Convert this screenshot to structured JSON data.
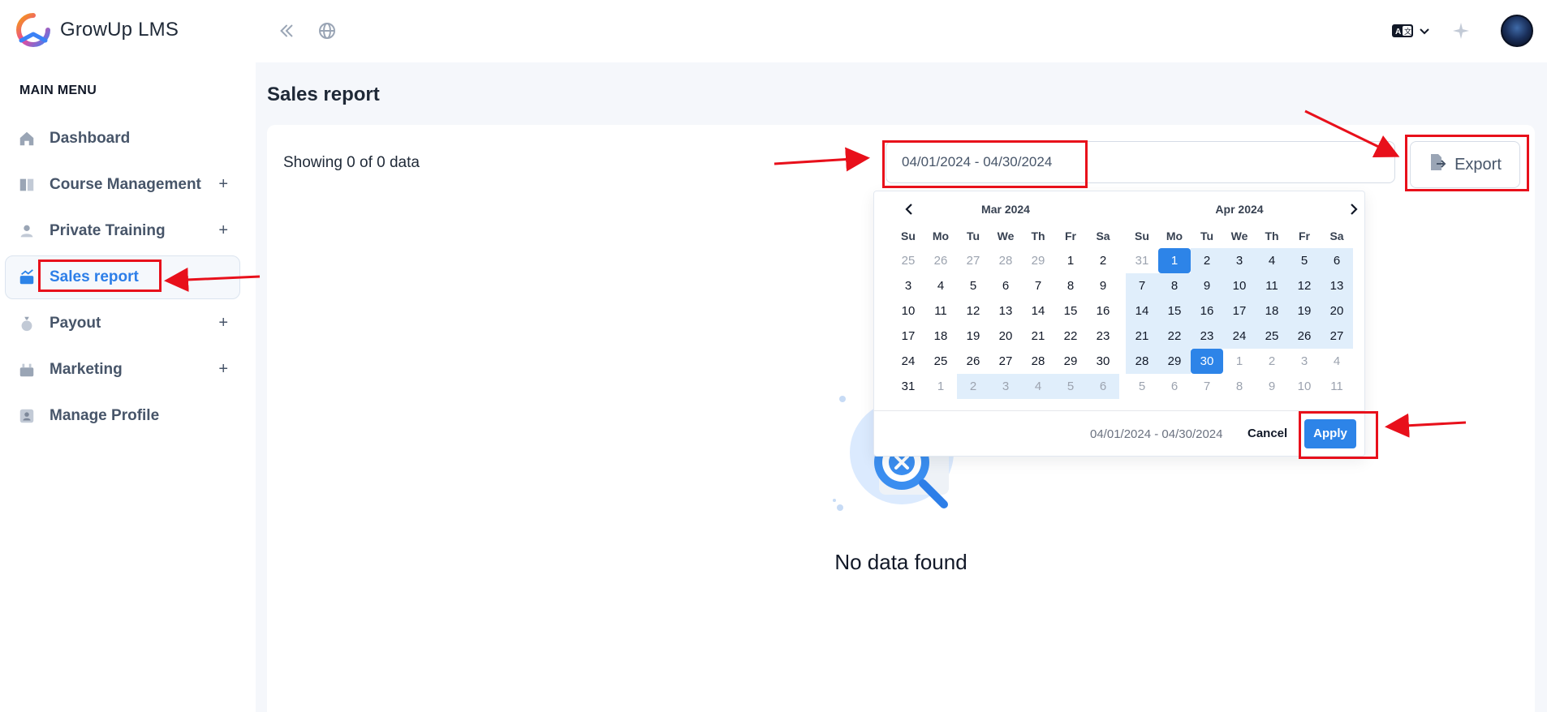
{
  "app": {
    "name": "GrowUp LMS"
  },
  "sidebar": {
    "menu_title": "MAIN MENU",
    "items": [
      {
        "label": "Dashboard",
        "icon": "home-icon",
        "has_submenu": false
      },
      {
        "label": "Course Management",
        "icon": "book-icon",
        "has_submenu": true
      },
      {
        "label": "Private Training",
        "icon": "users-icon",
        "has_submenu": true
      },
      {
        "label": "Sales report",
        "icon": "chart-icon",
        "has_submenu": false,
        "active": true
      },
      {
        "label": "Payout",
        "icon": "money-bag-icon",
        "has_submenu": true
      },
      {
        "label": "Marketing",
        "icon": "megaphone-icon",
        "has_submenu": true
      },
      {
        "label": "Manage Profile",
        "icon": "profile-icon",
        "has_submenu": false
      }
    ],
    "submenu_symbol": "+"
  },
  "topbar": {
    "collapse_icon": "double-chevron-left-icon",
    "globe_icon": "globe-icon",
    "language_icon": "translate-icon",
    "dropdown_icon": "chevron-down-icon",
    "sparkle_icon": "sparkle-icon",
    "avatar_icon": "user-avatar"
  },
  "page": {
    "title": "Sales report",
    "showing_text": "Showing 0 of 0 data",
    "date_range_value": "04/01/2024 - 04/30/2024",
    "export_label": "Export",
    "empty_text": "No data found"
  },
  "datepicker": {
    "weekdays": [
      "Su",
      "Mo",
      "Tu",
      "We",
      "Th",
      "Fr",
      "Sa"
    ],
    "left": {
      "title": "Mar 2024",
      "days": [
        {
          "d": "25",
          "s": "off"
        },
        {
          "d": "26",
          "s": "off"
        },
        {
          "d": "27",
          "s": "off"
        },
        {
          "d": "28",
          "s": "off"
        },
        {
          "d": "29",
          "s": "off"
        },
        {
          "d": "1",
          "s": ""
        },
        {
          "d": "2",
          "s": ""
        },
        {
          "d": "3",
          "s": ""
        },
        {
          "d": "4",
          "s": ""
        },
        {
          "d": "5",
          "s": ""
        },
        {
          "d": "6",
          "s": ""
        },
        {
          "d": "7",
          "s": ""
        },
        {
          "d": "8",
          "s": ""
        },
        {
          "d": "9",
          "s": ""
        },
        {
          "d": "10",
          "s": ""
        },
        {
          "d": "11",
          "s": ""
        },
        {
          "d": "12",
          "s": ""
        },
        {
          "d": "13",
          "s": ""
        },
        {
          "d": "14",
          "s": ""
        },
        {
          "d": "15",
          "s": ""
        },
        {
          "d": "16",
          "s": ""
        },
        {
          "d": "17",
          "s": ""
        },
        {
          "d": "18",
          "s": ""
        },
        {
          "d": "19",
          "s": ""
        },
        {
          "d": "20",
          "s": ""
        },
        {
          "d": "21",
          "s": ""
        },
        {
          "d": "22",
          "s": ""
        },
        {
          "d": "23",
          "s": ""
        },
        {
          "d": "24",
          "s": ""
        },
        {
          "d": "25",
          "s": ""
        },
        {
          "d": "26",
          "s": ""
        },
        {
          "d": "27",
          "s": ""
        },
        {
          "d": "28",
          "s": ""
        },
        {
          "d": "29",
          "s": ""
        },
        {
          "d": "30",
          "s": ""
        },
        {
          "d": "31",
          "s": ""
        },
        {
          "d": "1",
          "s": "off"
        },
        {
          "d": "2",
          "s": "off range"
        },
        {
          "d": "3",
          "s": "off range"
        },
        {
          "d": "4",
          "s": "off range"
        },
        {
          "d": "5",
          "s": "off range"
        },
        {
          "d": "6",
          "s": "off range"
        }
      ]
    },
    "right": {
      "title": "Apr 2024",
      "days": [
        {
          "d": "31",
          "s": "off"
        },
        {
          "d": "1",
          "s": "sel"
        },
        {
          "d": "2",
          "s": "range"
        },
        {
          "d": "3",
          "s": "range"
        },
        {
          "d": "4",
          "s": "range"
        },
        {
          "d": "5",
          "s": "range"
        },
        {
          "d": "6",
          "s": "range"
        },
        {
          "d": "7",
          "s": "range"
        },
        {
          "d": "8",
          "s": "range"
        },
        {
          "d": "9",
          "s": "range"
        },
        {
          "d": "10",
          "s": "range"
        },
        {
          "d": "11",
          "s": "range"
        },
        {
          "d": "12",
          "s": "range"
        },
        {
          "d": "13",
          "s": "range"
        },
        {
          "d": "14",
          "s": "range"
        },
        {
          "d": "15",
          "s": "range"
        },
        {
          "d": "16",
          "s": "range"
        },
        {
          "d": "17",
          "s": "range"
        },
        {
          "d": "18",
          "s": "range"
        },
        {
          "d": "19",
          "s": "range"
        },
        {
          "d": "20",
          "s": "range"
        },
        {
          "d": "21",
          "s": "range"
        },
        {
          "d": "22",
          "s": "range"
        },
        {
          "d": "23",
          "s": "range"
        },
        {
          "d": "24",
          "s": "range"
        },
        {
          "d": "25",
          "s": "range"
        },
        {
          "d": "26",
          "s": "range"
        },
        {
          "d": "27",
          "s": "range"
        },
        {
          "d": "28",
          "s": "range"
        },
        {
          "d": "29",
          "s": "range"
        },
        {
          "d": "30",
          "s": "sel"
        },
        {
          "d": "1",
          "s": "off"
        },
        {
          "d": "2",
          "s": "off"
        },
        {
          "d": "3",
          "s": "off"
        },
        {
          "d": "4",
          "s": "off"
        },
        {
          "d": "5",
          "s": "off"
        },
        {
          "d": "6",
          "s": "off"
        },
        {
          "d": "7",
          "s": "off"
        },
        {
          "d": "8",
          "s": "off"
        },
        {
          "d": "9",
          "s": "off"
        },
        {
          "d": "10",
          "s": "off"
        },
        {
          "d": "11",
          "s": "off"
        }
      ]
    },
    "footer_range": "04/01/2024 - 04/30/2024",
    "cancel_label": "Cancel",
    "apply_label": "Apply"
  },
  "colors": {
    "accent": "#2d84e8",
    "annotation_red": "#e8101b",
    "range_bg": "#e0eefb"
  }
}
